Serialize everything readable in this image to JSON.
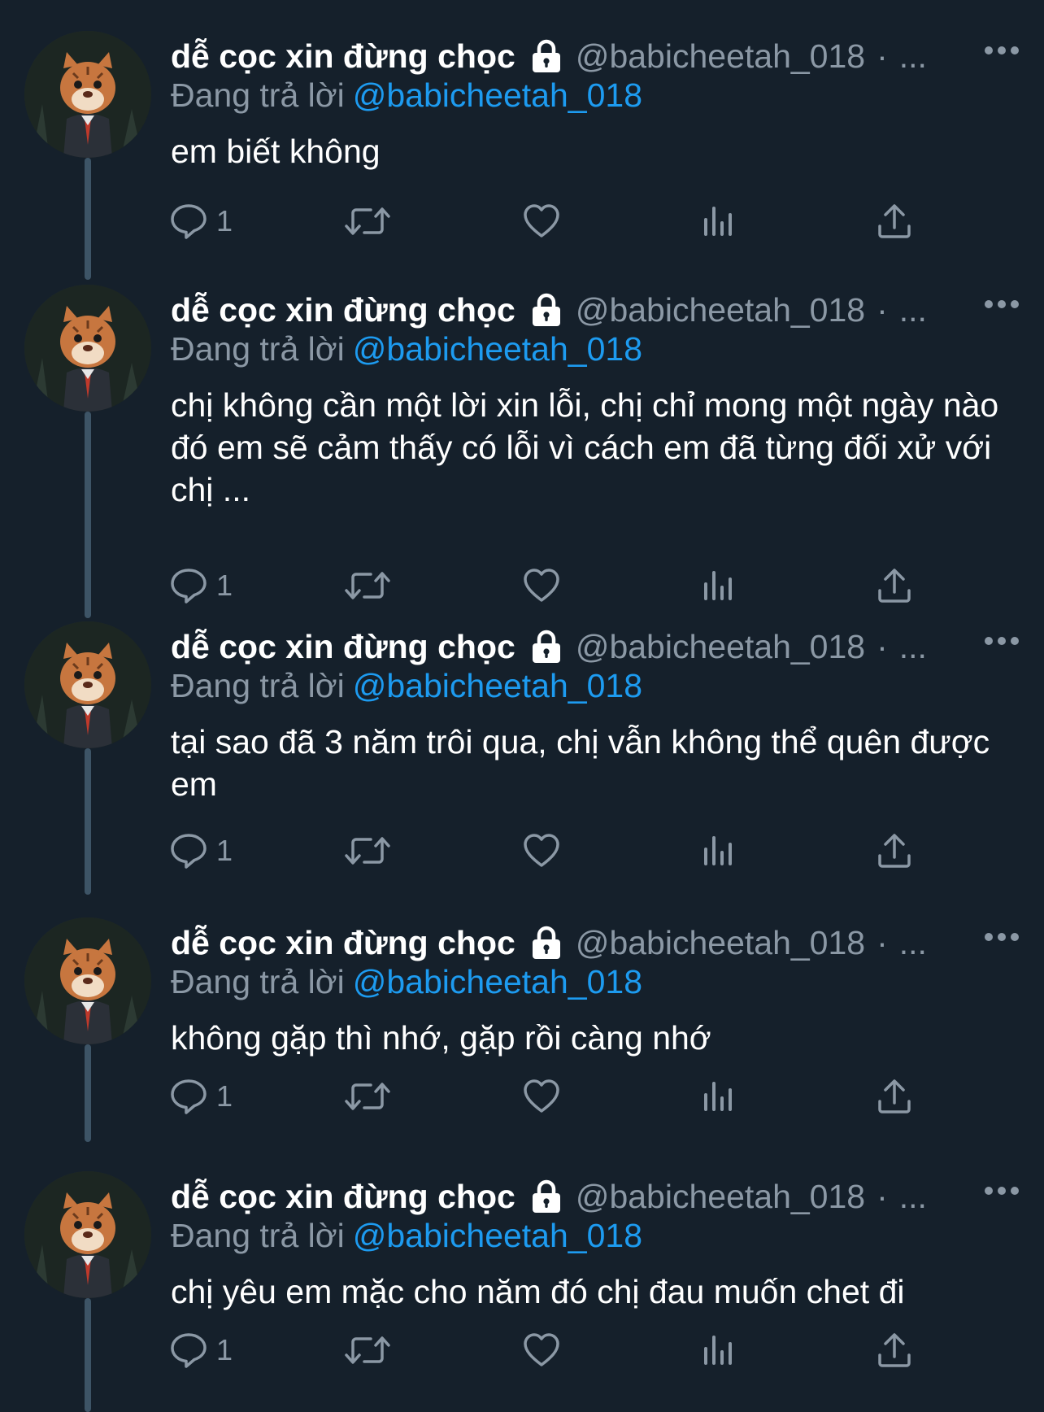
{
  "author": {
    "display_name": "dễ cọc xin đừng chọc",
    "handle": "@babicheetah_018",
    "separator": "·",
    "truncated": "...",
    "replying_label": "Đang trả lời",
    "reply_to": "@babicheetah_018"
  },
  "icons": {
    "locked": "lock-icon",
    "more": "more-icon",
    "reply": "reply-icon",
    "retweet": "retweet-icon",
    "like": "like-icon",
    "views": "views-icon",
    "share": "share-icon"
  },
  "colors": {
    "background": "#15202b",
    "mention": "#1d9bf0",
    "muted": "#8b98a5",
    "thread_line": "#3d5466"
  },
  "tweets": [
    {
      "text": "em biết không",
      "reply_count": "1"
    },
    {
      "text": "chị không cần một lời xin lỗi, chị chỉ mong một ngày nào đó em sẽ cảm thấy có lỗi vì cách em đã từng đối xử với chị ...",
      "reply_count": "1"
    },
    {
      "text": "tại sao đã 3 năm trôi qua, chị vẫn không thể quên được em",
      "reply_count": "1"
    },
    {
      "text": "không gặp thì nhớ, gặp rồi càng nhớ",
      "reply_count": "1"
    },
    {
      "text": "chị yêu em mặc cho năm đó chị đau muốn chet đi",
      "reply_count": "1"
    }
  ]
}
